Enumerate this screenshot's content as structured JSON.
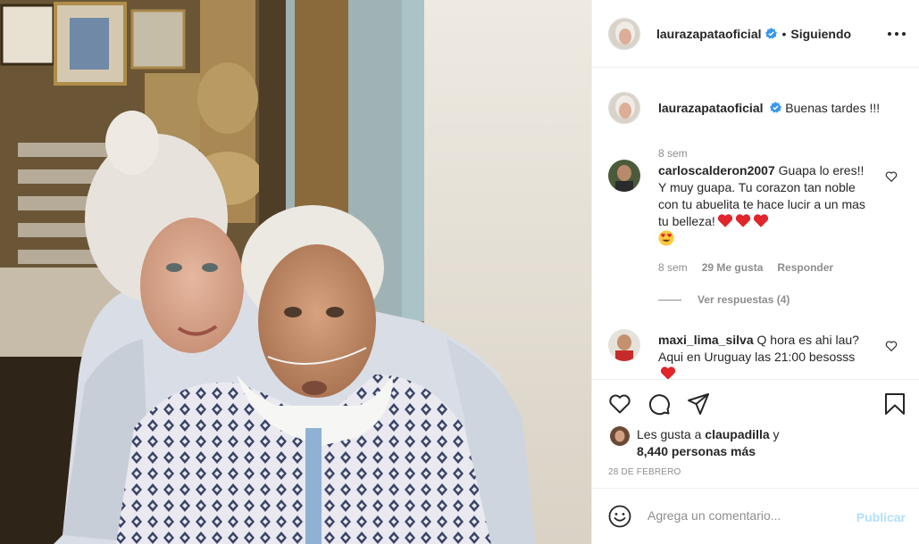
{
  "post": {
    "username": "laurazapataoficial",
    "follow_dot": "•",
    "follow_status": "Siguiendo",
    "caption_username": "laurazapataoficial",
    "caption_text": "Buenas tardes !!!",
    "caption_time": "8 sem"
  },
  "comments": [
    {
      "username": "carloscalderon2007",
      "text": "Guapa lo eres!! Y muy guapa. Tu corazon tan noble con tu abuelita te hace lucir a un mas tu belleza!",
      "emojis": [
        "red-heart",
        "red-heart",
        "red-heart",
        "heart-eyes"
      ],
      "time": "8 sem",
      "likes": "29 Me gusta",
      "reply": "Responder",
      "view_replies": "Ver respuestas (4)"
    },
    {
      "username": "maxi_lima_silva",
      "text": "Q hora es ahi lau? Aqui en Uruguay las 21:00 besosss",
      "emojis": [
        "red-heart"
      ]
    }
  ],
  "likes": {
    "prefix": "Les gusta a ",
    "user": "claupadilla",
    "middle": " y",
    "count": "8,440 personas más"
  },
  "date": "28 DE FEBRERO",
  "add_comment": {
    "placeholder": "Agrega un comentario...",
    "publish": "Publicar"
  },
  "icons": {
    "verified": "verified-badge-icon",
    "like": "heart-icon",
    "comment": "comment-icon",
    "share": "share-icon",
    "save": "bookmark-icon",
    "emoji": "smiley-icon",
    "more": "more-options-icon"
  },
  "colors": {
    "verified_blue": "#3897f0",
    "text": "#262626",
    "muted": "#8e8e8e",
    "publish_disabled": "#b2dffc",
    "heart_red": "#ed4956"
  }
}
